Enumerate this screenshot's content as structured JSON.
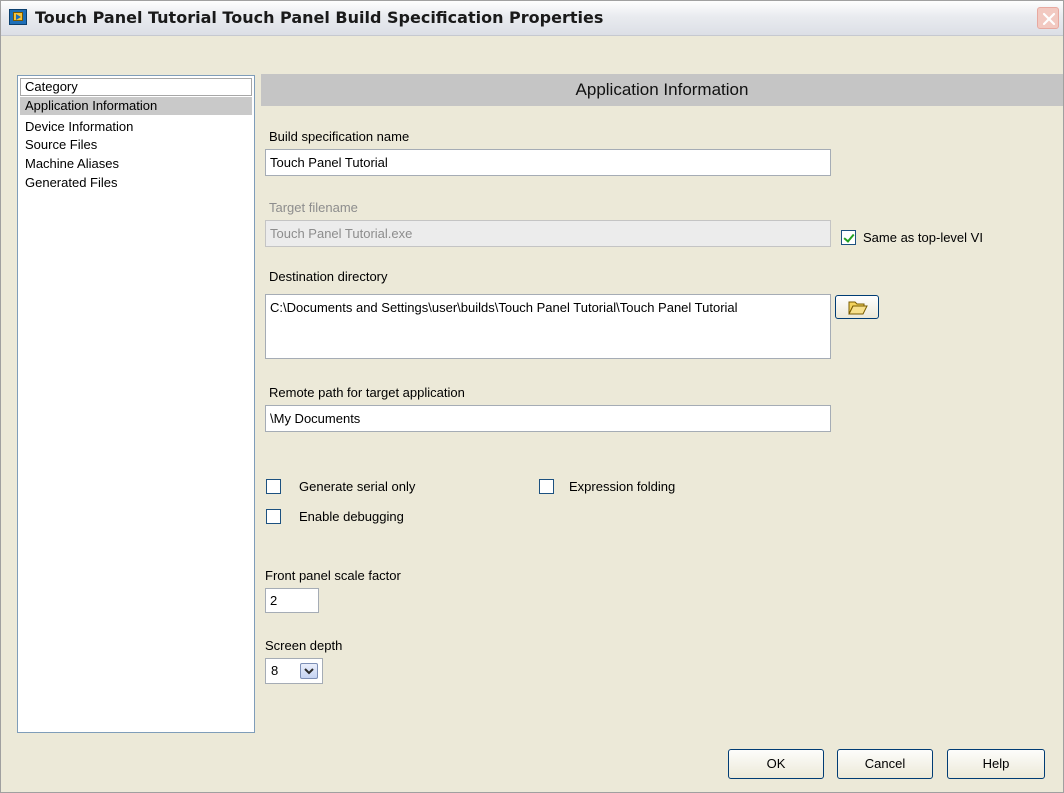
{
  "window": {
    "title": "Touch Panel Tutorial Touch Panel Build Specification Properties"
  },
  "category": {
    "header": "Category",
    "items": [
      {
        "label": "Application Information",
        "selected": true
      },
      {
        "label": "Device Information",
        "selected": false
      },
      {
        "label": "Source Files",
        "selected": false
      },
      {
        "label": "Machine Aliases",
        "selected": false
      },
      {
        "label": "Generated Files",
        "selected": false
      }
    ]
  },
  "section": {
    "title": "Application Information"
  },
  "fields": {
    "build_spec_name": {
      "label": "Build specification name",
      "value": "Touch Panel Tutorial"
    },
    "target_filename": {
      "label": "Target filename",
      "value": "Touch Panel Tutorial.exe",
      "enabled": false
    },
    "same_as_top_level": {
      "label": "Same as top-level VI",
      "checked": true
    },
    "destination_directory": {
      "label": "Destination directory",
      "value": "C:\\Documents and Settings\\user\\builds\\Touch Panel Tutorial\\Touch Panel Tutorial"
    },
    "remote_path": {
      "label": "Remote path for target application",
      "value": "\\My Documents"
    },
    "front_panel_scale": {
      "label": "Front panel scale factor",
      "value": "2"
    },
    "screen_depth": {
      "label": "Screen depth",
      "value": "8"
    }
  },
  "options": {
    "generate_serial_only": {
      "label": "Generate serial only",
      "checked": false
    },
    "expression_folding": {
      "label": "Expression folding",
      "checked": false
    },
    "enable_debugging": {
      "label": "Enable debugging",
      "checked": false
    }
  },
  "buttons": {
    "ok": "OK",
    "cancel": "Cancel",
    "help": "Help"
  },
  "icons": {
    "app": "labview-icon",
    "close": "close-icon",
    "browse": "folder-open-icon",
    "dropdown": "chevron-down-icon"
  },
  "colors": {
    "selected_item_bg": "#c9c9c9",
    "section_header_bg": "#c5c5c5",
    "dialog_bg": "#ece9d8",
    "check_mark": "#21a121"
  }
}
